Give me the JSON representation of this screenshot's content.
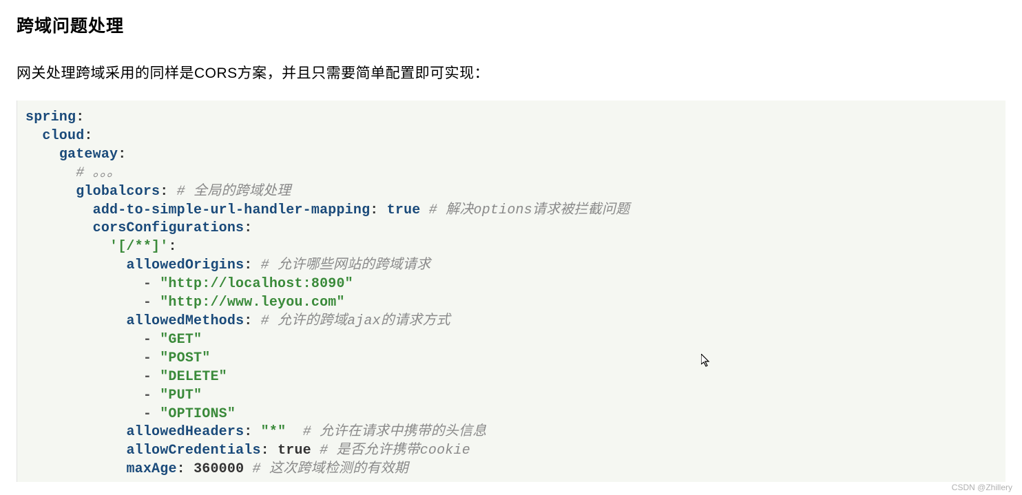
{
  "title": "跨域问题处理",
  "description": "网关处理跨域采用的同样是CORS方案，并且只需要简单配置即可实现：",
  "code": {
    "k_spring": "spring",
    "k_cloud": "cloud",
    "k_gateway": "gateway",
    "c_ellipsis": "# 。。。",
    "k_globalcors": "globalcors",
    "c_globalcors": "# 全局的跨域处理",
    "k_addto": "add-to-simple-url-handler-mapping",
    "b_true1": "true",
    "c_addto": "# 解决options请求被拦截问题",
    "k_corscfg": "corsConfigurations",
    "s_path": "'[/**]'",
    "k_allowedorigins": "allowedOrigins",
    "c_allowedorigins": "# 允许哪些网站的跨域请求",
    "s_origin1": "\"http://localhost:8090\"",
    "s_origin2": "\"http://www.leyou.com\"",
    "k_allowedmethods": "allowedMethods",
    "c_allowedmethods": "# 允许的跨域ajax的请求方式",
    "s_m_get": "\"GET\"",
    "s_m_post": "\"POST\"",
    "s_m_delete": "\"DELETE\"",
    "s_m_put": "\"PUT\"",
    "s_m_options": "\"OPTIONS\"",
    "k_allowedheaders": "allowedHeaders",
    "s_star": "\"*\"",
    "c_allowedheaders": "# 允许在请求中携带的头信息",
    "k_allowcredentials": "allowCredentials",
    "b_true2": "true",
    "c_allowcredentials": "# 是否允许携带cookie",
    "k_maxage": "maxAge",
    "n_maxage": "360000",
    "c_maxage": "# 这次跨域检测的有效期"
  },
  "watermark": "CSDN @Zhillery"
}
